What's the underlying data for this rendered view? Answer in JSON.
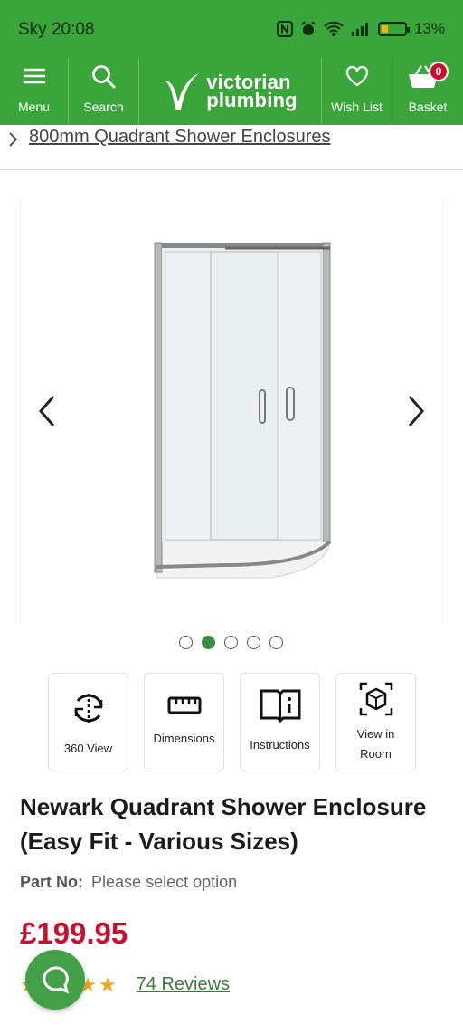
{
  "status_bar": {
    "time": "Sky 20:08",
    "battery_percent": "13%",
    "battery_level": 0.13
  },
  "header": {
    "brand_colors": {
      "green": "#3aa53a",
      "badge_red": "#c8102e"
    },
    "menu_label": "Menu",
    "search_label": "Search",
    "logo_text_line1": "victorian",
    "logo_text_line2": "plumbing",
    "wishlist_label": "Wish List",
    "basket_label": "Basket",
    "basket_count": "0"
  },
  "breadcrumb": {
    "label": "800mm Quadrant Shower Enclosures"
  },
  "gallery": {
    "image_count": 5,
    "active_index": 1
  },
  "features": [
    {
      "label": "360 View",
      "icon": "rotate-360-icon"
    },
    {
      "label": "Dimensions",
      "icon": "ruler-icon"
    },
    {
      "label": "Instructions",
      "icon": "book-info-icon"
    },
    {
      "label": "View in Room",
      "icon": "ar-cube-icon"
    }
  ],
  "product": {
    "title": "Newark Quadrant Shower Enclosure (Easy Fit - Various Sizes)",
    "part_no_label": "Part No:",
    "part_no_value": "Please select option",
    "price": "£199.95",
    "rating_stars": 5,
    "reviews": "74 Reviews"
  }
}
